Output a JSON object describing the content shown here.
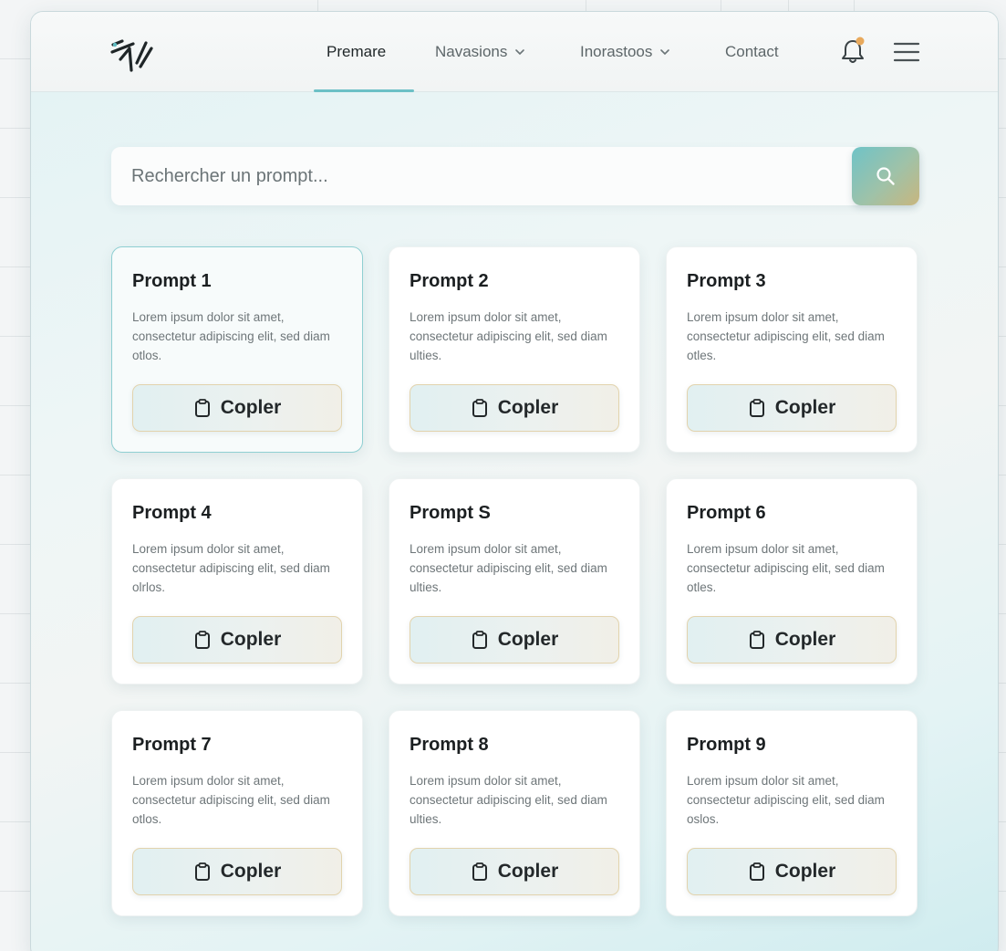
{
  "nav": {
    "logo_icon": "brand-logo",
    "items": [
      {
        "label": "Premare",
        "active": true,
        "has_dropdown": false
      },
      {
        "label": "Navasions",
        "active": false,
        "has_dropdown": true
      },
      {
        "label": "Inorastoos",
        "active": false,
        "has_dropdown": true
      },
      {
        "label": "Contact",
        "active": false,
        "has_dropdown": false
      }
    ],
    "bell_icon": "bell-icon",
    "menu_icon": "hamburger-menu-icon"
  },
  "search": {
    "placeholder": "Rechercher un prompt...",
    "value": "",
    "button_icon": "search-icon"
  },
  "cards": [
    {
      "title": "Prompt 1",
      "description": "Lorem ipsum dolor sit amet, consectetur adipiscing elit, sed diam otlos.",
      "button_label": "Copler",
      "selected": true
    },
    {
      "title": "Prompt 2",
      "description": "Lorem ipsum dolor sit amet, consectetur adipiscing elit, sed diam ulties.",
      "button_label": "Copler",
      "selected": false
    },
    {
      "title": "Prompt 3",
      "description": "Lorem ipsum dolor sit amet, consectetur adipiscing elit, sed diam otles.",
      "button_label": "Copler",
      "selected": false
    },
    {
      "title": "Prompt 4",
      "description": "Lorem ipsum dolor sit amet, consectetur adipiscing elit, sed diam olrlos.",
      "button_label": "Copler",
      "selected": false
    },
    {
      "title": "Prompt S",
      "description": "Lorem ipsum dolor sit amet, consectetur adipiscing elit, sed diam ulties.",
      "button_label": "Copler",
      "selected": false
    },
    {
      "title": "Prompt 6",
      "description": "Lorem ipsum dolor sit amet, consectetur adipiscing elit, sed diam otles.",
      "button_label": "Copler",
      "selected": false
    },
    {
      "title": "Prompt 7",
      "description": "Lorem ipsum dolor sit amet, consectetur adipiscing elit, sed diam otlos.",
      "button_label": "Copler",
      "selected": false
    },
    {
      "title": "Prompt 8",
      "description": "Lorem ipsum dolor sit amet, consectetur adipiscing elit, sed diam ulties.",
      "button_label": "Copler",
      "selected": false
    },
    {
      "title": "Prompt 9",
      "description": "Lorem ipsum dolor sit amet, consectetur adipiscing elit, sed diam oslos.",
      "button_label": "Copler",
      "selected": false
    }
  ],
  "colors": {
    "accent": "#6cc0c6",
    "button_border": "#e2d3ad",
    "notification_dot": "#e8a95c"
  }
}
